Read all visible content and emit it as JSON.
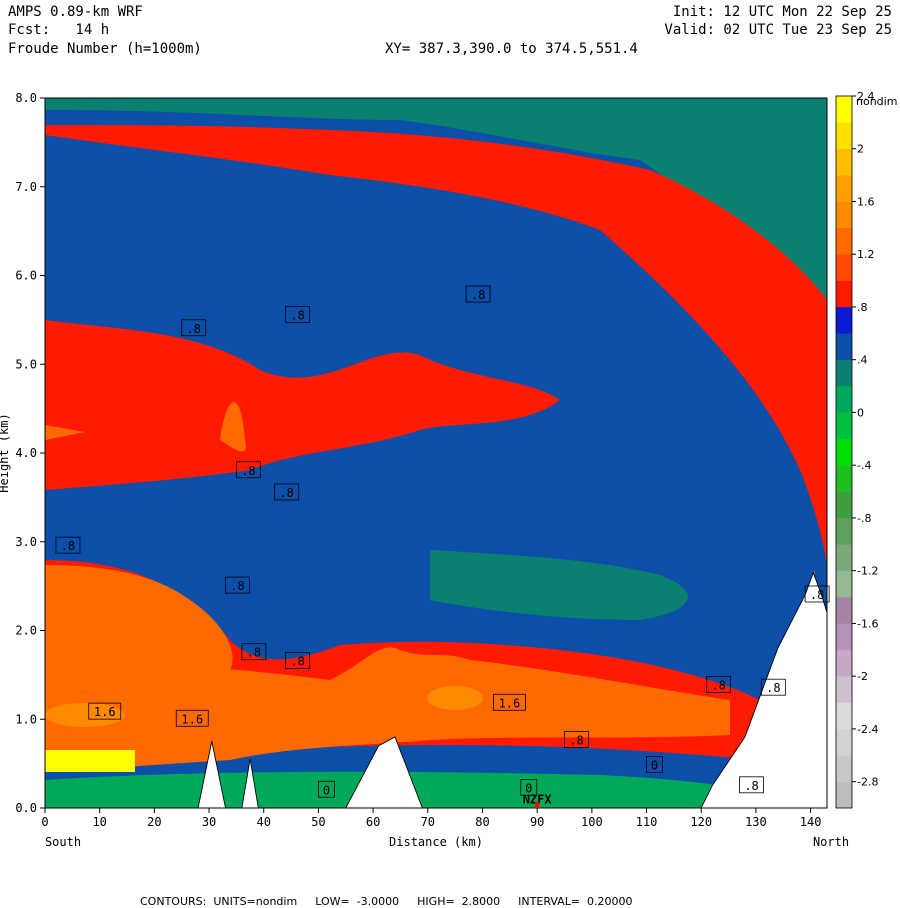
{
  "header": {
    "model": "AMPS 0.89-km WRF",
    "fcst": "Fcst:   14 h",
    "field": "Froude Number (h=1000m)",
    "init": "Init: 12 UTC Mon 22 Sep 25",
    "valid": "Valid: 02 UTC Tue 23 Sep 25",
    "xy": "XY= 387.3,390.0 to 374.5,551.4"
  },
  "footer": {
    "contours": "CONTOURS:  UNITS=nondim",
    "low": "LOW=  -3.0000",
    "high": "HIGH=  2.8000",
    "interval": "INTERVAL=  0.20000"
  },
  "chart_data": {
    "type": "heatmap",
    "title": "Froude Number (h=1000m)",
    "xlabel": "Distance (km)",
    "ylabel": "Height (km)",
    "xlim": [
      0,
      143
    ],
    "ylim": [
      0,
      8
    ],
    "x_ticks": [
      0,
      10,
      20,
      30,
      40,
      50,
      60,
      70,
      80,
      90,
      100,
      110,
      120,
      130,
      140
    ],
    "y_ticks": [
      "0.0",
      "1.0",
      "2.0",
      "3.0",
      "4.0",
      "5.0",
      "6.0",
      "7.0",
      "8.0"
    ],
    "x_end_labels": {
      "left": "South",
      "right": "North"
    },
    "station_label": "NZFX",
    "colorbar": {
      "unit": "nondim",
      "levels": [
        -3.0,
        2.8,
        0.2
      ],
      "tick_labels": [
        "2.4",
        "2",
        "1.6",
        "1.2",
        ".8",
        ".4",
        "0",
        "-.4",
        "-.8",
        "-1.2",
        "-1.6",
        "-2",
        "-2.4",
        "-2.8"
      ],
      "colors_bottom_to_top": [
        "#bdbdbd",
        "#c8c8c8",
        "#d2d2d2",
        "#dcdcdc",
        "#cfc0cf",
        "#c4a8c4",
        "#b893b8",
        "#a583a5",
        "#94b894",
        "#7aaa7a",
        "#5fa05f",
        "#3f9f3f",
        "#1fbf1f",
        "#00e000",
        "#00c040",
        "#00a85a",
        "#0a8070",
        "#0c4fa8",
        "#0a1ad0",
        "#ff1a00",
        "#ff4a00",
        "#ff6a00",
        "#ff8a00",
        "#ffa000",
        "#ffbf00",
        "#ffe000",
        "#ffff00"
      ]
    },
    "contour_labels": [
      {
        "x": 2,
        "y": 2.95,
        "text": ".8"
      },
      {
        "x": 25,
        "y": 5.4,
        "text": ".8"
      },
      {
        "x": 44,
        "y": 5.55,
        "text": ".8"
      },
      {
        "x": 77,
        "y": 5.78,
        "text": ".8"
      },
      {
        "x": 35,
        "y": 3.8,
        "text": ".8"
      },
      {
        "x": 42,
        "y": 3.55,
        "text": ".8"
      },
      {
        "x": 33,
        "y": 2.5,
        "text": ".8"
      },
      {
        "x": 36,
        "y": 1.75,
        "text": ".8"
      },
      {
        "x": 44,
        "y": 1.65,
        "text": ".8"
      },
      {
        "x": 8,
        "y": 1.08,
        "text": "1.6"
      },
      {
        "x": 24,
        "y": 1.0,
        "text": "1.6"
      },
      {
        "x": 82,
        "y": 1.18,
        "text": "1.6"
      },
      {
        "x": 95,
        "y": 0.76,
        "text": ".8"
      },
      {
        "x": 121,
        "y": 1.38,
        "text": ".8"
      },
      {
        "x": 131,
        "y": 1.35,
        "text": ".8"
      },
      {
        "x": 139,
        "y": 2.4,
        "text": ".8"
      },
      {
        "x": 127,
        "y": 0.25,
        "text": ".8"
      },
      {
        "x": 50,
        "y": 0.2,
        "text": "0"
      },
      {
        "x": 87,
        "y": 0.22,
        "text": "0"
      },
      {
        "x": 110,
        "y": 0.48,
        "text": "0"
      }
    ]
  }
}
